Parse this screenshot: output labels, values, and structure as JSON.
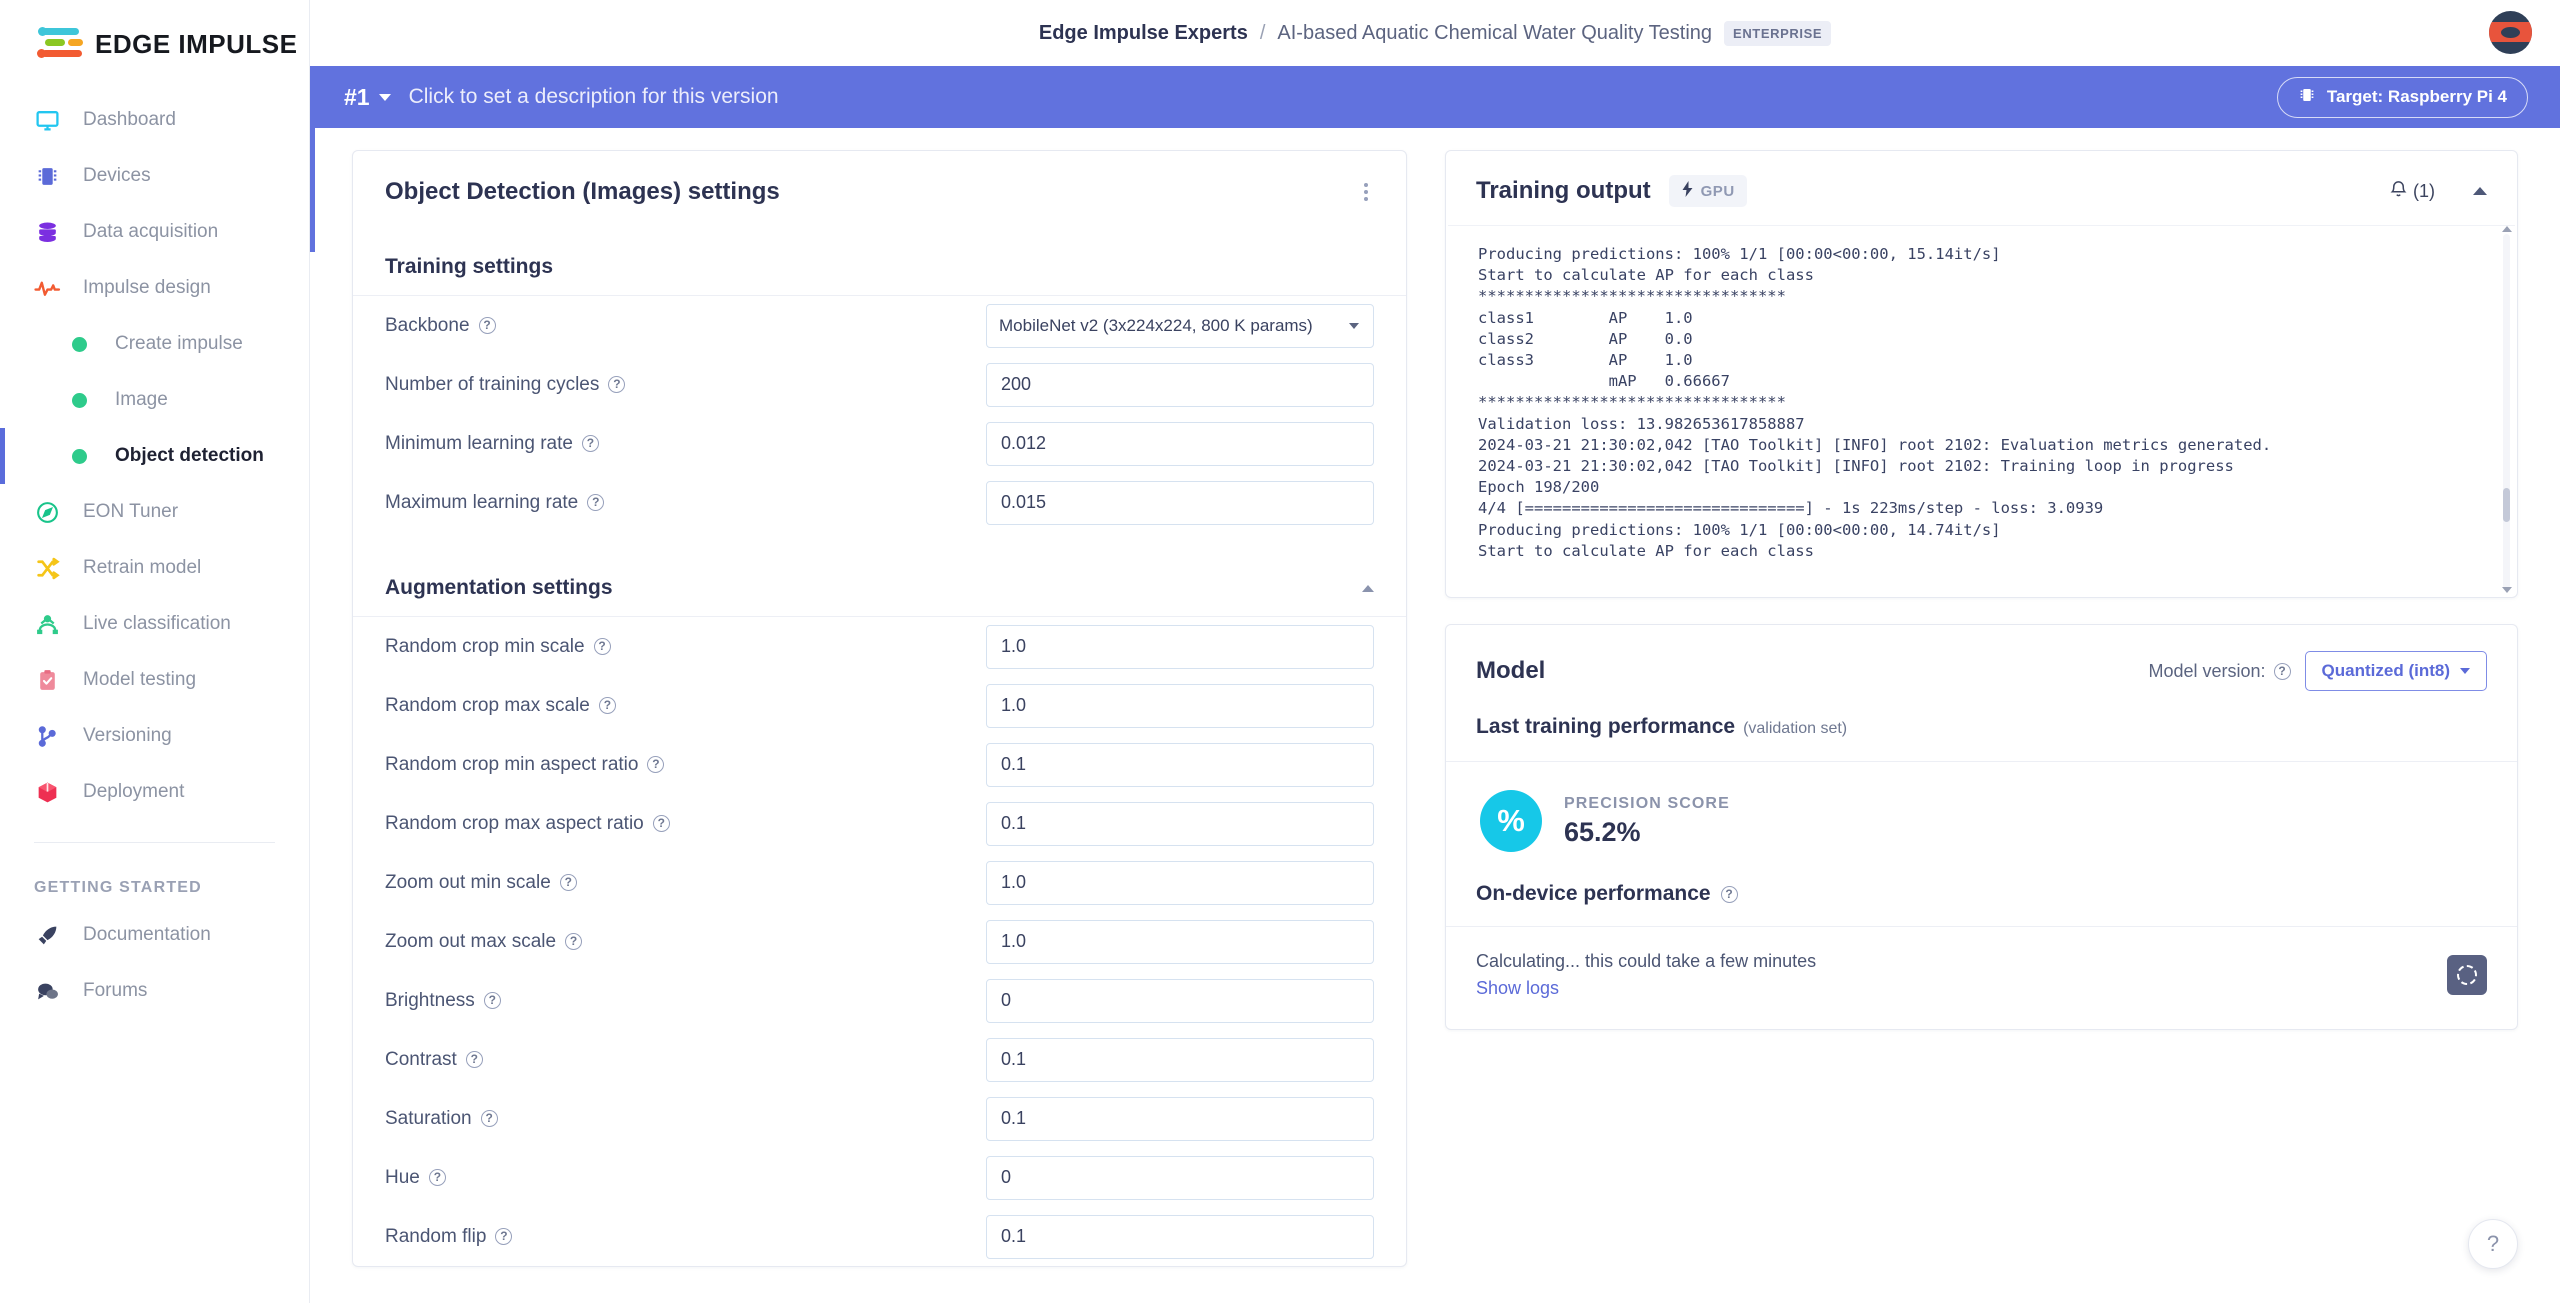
{
  "brand": {
    "name": "EDGE IMPULSE",
    "accent_purple": "#6172de",
    "accent_blue": "#5b6ad8"
  },
  "sidebar": {
    "items": [
      {
        "label": "Dashboard",
        "icon": "monitor-icon",
        "color": "#22c6f0"
      },
      {
        "label": "Devices",
        "icon": "chip-icon",
        "color": "#5b6ad8"
      },
      {
        "label": "Data acquisition",
        "icon": "database-icon",
        "color": "#7b2fe0"
      },
      {
        "label": "Impulse design",
        "icon": "pulse-icon",
        "color": "#f25b32"
      }
    ],
    "sub_items": [
      {
        "label": "Create impulse",
        "active": false
      },
      {
        "label": "Image",
        "active": false
      },
      {
        "label": "Object detection",
        "active": true
      }
    ],
    "items2": [
      {
        "label": "EON Tuner",
        "icon": "compass-icon",
        "color": "#18c48a"
      },
      {
        "label": "Retrain model",
        "icon": "shuffle-icon",
        "color": "#f5c518"
      },
      {
        "label": "Live classification",
        "icon": "network-icon",
        "color": "#2ecb8b"
      },
      {
        "label": "Model testing",
        "icon": "clipboard-check-icon",
        "color": "#ef8a9b"
      },
      {
        "label": "Versioning",
        "icon": "git-branch-icon",
        "color": "#5b6ad8"
      },
      {
        "label": "Deployment",
        "icon": "cube-icon",
        "color": "#ee2f52"
      }
    ],
    "getting_started_label": "GETTING STARTED",
    "footer_items": [
      {
        "label": "Documentation",
        "icon": "rocket-icon",
        "color": "#3a4260"
      },
      {
        "label": "Forums",
        "icon": "chat-icon",
        "color": "#3a4260"
      }
    ]
  },
  "header": {
    "org": "Edge Impulse Experts",
    "separator": "/",
    "project": "AI-based Aquatic Chemical Water Quality Testing",
    "badge": "ENTERPRISE"
  },
  "version_bar": {
    "number": "#1",
    "description": "Click to set a description for this version",
    "target_label": "Target: Raspberry Pi 4"
  },
  "settings_card": {
    "title": "Object Detection (Images) settings",
    "training_section": "Training settings",
    "augmentation_section": "Augmentation settings",
    "fields": [
      {
        "label": "Backbone",
        "value": "MobileNet v2 (3x224x224, 800 K params)",
        "type": "select"
      },
      {
        "label": "Number of training cycles",
        "value": "200",
        "type": "text"
      },
      {
        "label": "Minimum learning rate",
        "value": "0.012",
        "type": "text"
      },
      {
        "label": "Maximum learning rate",
        "value": "0.015",
        "type": "text"
      }
    ],
    "aug_fields": [
      {
        "label": "Random crop min scale",
        "value": "1.0"
      },
      {
        "label": "Random crop max scale",
        "value": "1.0"
      },
      {
        "label": "Random crop min aspect ratio",
        "value": "0.1"
      },
      {
        "label": "Random crop max aspect ratio",
        "value": "0.1"
      },
      {
        "label": "Zoom out min scale",
        "value": "1.0"
      },
      {
        "label": "Zoom out max scale",
        "value": "1.0"
      },
      {
        "label": "Brightness",
        "value": "0"
      },
      {
        "label": "Contrast",
        "value": "0.1"
      },
      {
        "label": "Saturation",
        "value": "0.1"
      },
      {
        "label": "Hue",
        "value": "0"
      },
      {
        "label": "Random flip",
        "value": "0.1"
      }
    ]
  },
  "training_output": {
    "title": "Training output",
    "gpu_badge": "GPU",
    "notification_count": "(1)",
    "log": "Producing predictions: 100% 1/1 [00:00<00:00, 15.14it/s]\nStart to calculate AP for each class\n*********************************\nclass1        AP    1.0\nclass2        AP    0.0\nclass3        AP    1.0\n              mAP   0.66667\n*********************************\nValidation loss: 13.982653617858887\n2024-03-21 21:30:02,042 [TAO Toolkit] [INFO] root 2102: Evaluation metrics generated.\n2024-03-21 21:30:02,042 [TAO Toolkit] [INFO] root 2102: Training loop in progress\nEpoch 198/200\n4/4 [==============================] - 1s 223ms/step - loss: 3.0939\nProducing predictions: 100% 1/1 [00:00<00:00, 14.74it/s]\nStart to calculate AP for each class"
  },
  "model_card": {
    "title": "Model",
    "version_label": "Model version:",
    "version_value": "Quantized (int8)",
    "last_training_performance": "Last training performance",
    "validation_set": "(validation set)",
    "precision_label": "PRECISION SCORE",
    "precision_value": "65.2%",
    "precision_icon": "%",
    "on_device_performance": "On-device performance",
    "calculating_text": "Calculating... this could take a few minutes",
    "show_logs_label": "Show logs"
  },
  "help_fab": {
    "label": "?"
  }
}
